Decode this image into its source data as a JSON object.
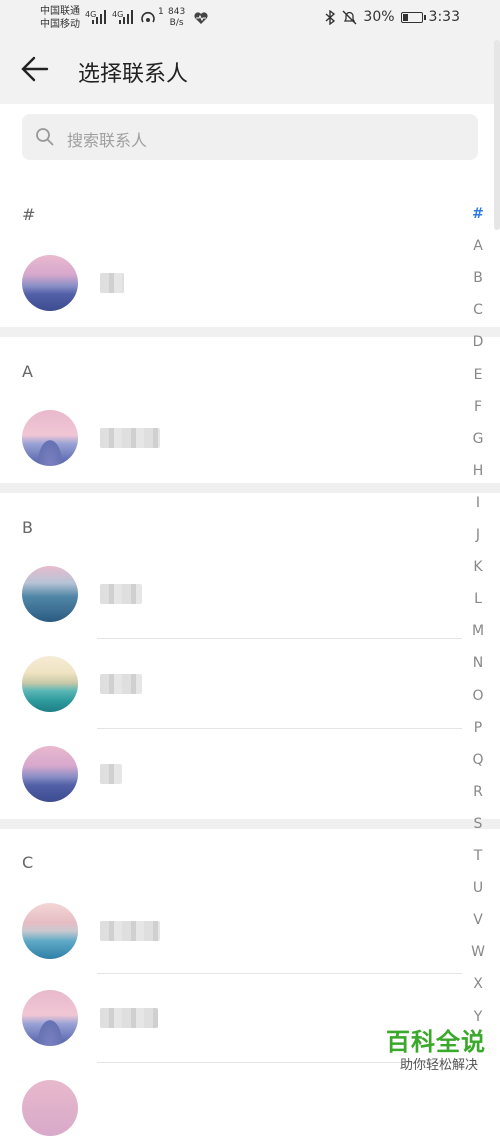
{
  "status_bar": {
    "carrier1": "中国联通",
    "carrier2": "中国移动",
    "sig1": "4G",
    "sig2": "4G",
    "hotspot_count": "1",
    "net_speed_value": "843",
    "net_speed_unit": "B/s",
    "battery_percent": "30%",
    "battery_level": 0.3,
    "time": "3:33"
  },
  "header": {
    "title": "选择联系人"
  },
  "search": {
    "placeholder": "搜索联系人"
  },
  "sections": [
    {
      "label": "#",
      "contacts": [
        {
          "avatar": "pink-lake"
        }
      ]
    },
    {
      "label": "A",
      "contacts": [
        {
          "avatar": "pink-mountain"
        }
      ]
    },
    {
      "label": "B",
      "contacts": [
        {
          "avatar": "blue-mountain"
        },
        {
          "avatar": "beach"
        },
        {
          "avatar": "pink-lake"
        }
      ]
    },
    {
      "label": "C",
      "contacts": [
        {
          "avatar": "sunset-sea"
        },
        {
          "avatar": "pink-mountain"
        }
      ]
    }
  ],
  "alphabet_index": [
    "#",
    "A",
    "B",
    "C",
    "D",
    "E",
    "F",
    "G",
    "H",
    "I",
    "J",
    "K",
    "L",
    "M",
    "N",
    "O",
    "P",
    "Q",
    "R",
    "S",
    "T",
    "U",
    "V",
    "W",
    "X",
    "Y"
  ],
  "alphabet_active": "#",
  "watermark": {
    "brand": "百科全说",
    "slogan": "助你轻松解决"
  },
  "colors": {
    "accent": "#2f7be0",
    "watermark_green": "#3aa82a",
    "header_bg": "#f2f2f2"
  }
}
